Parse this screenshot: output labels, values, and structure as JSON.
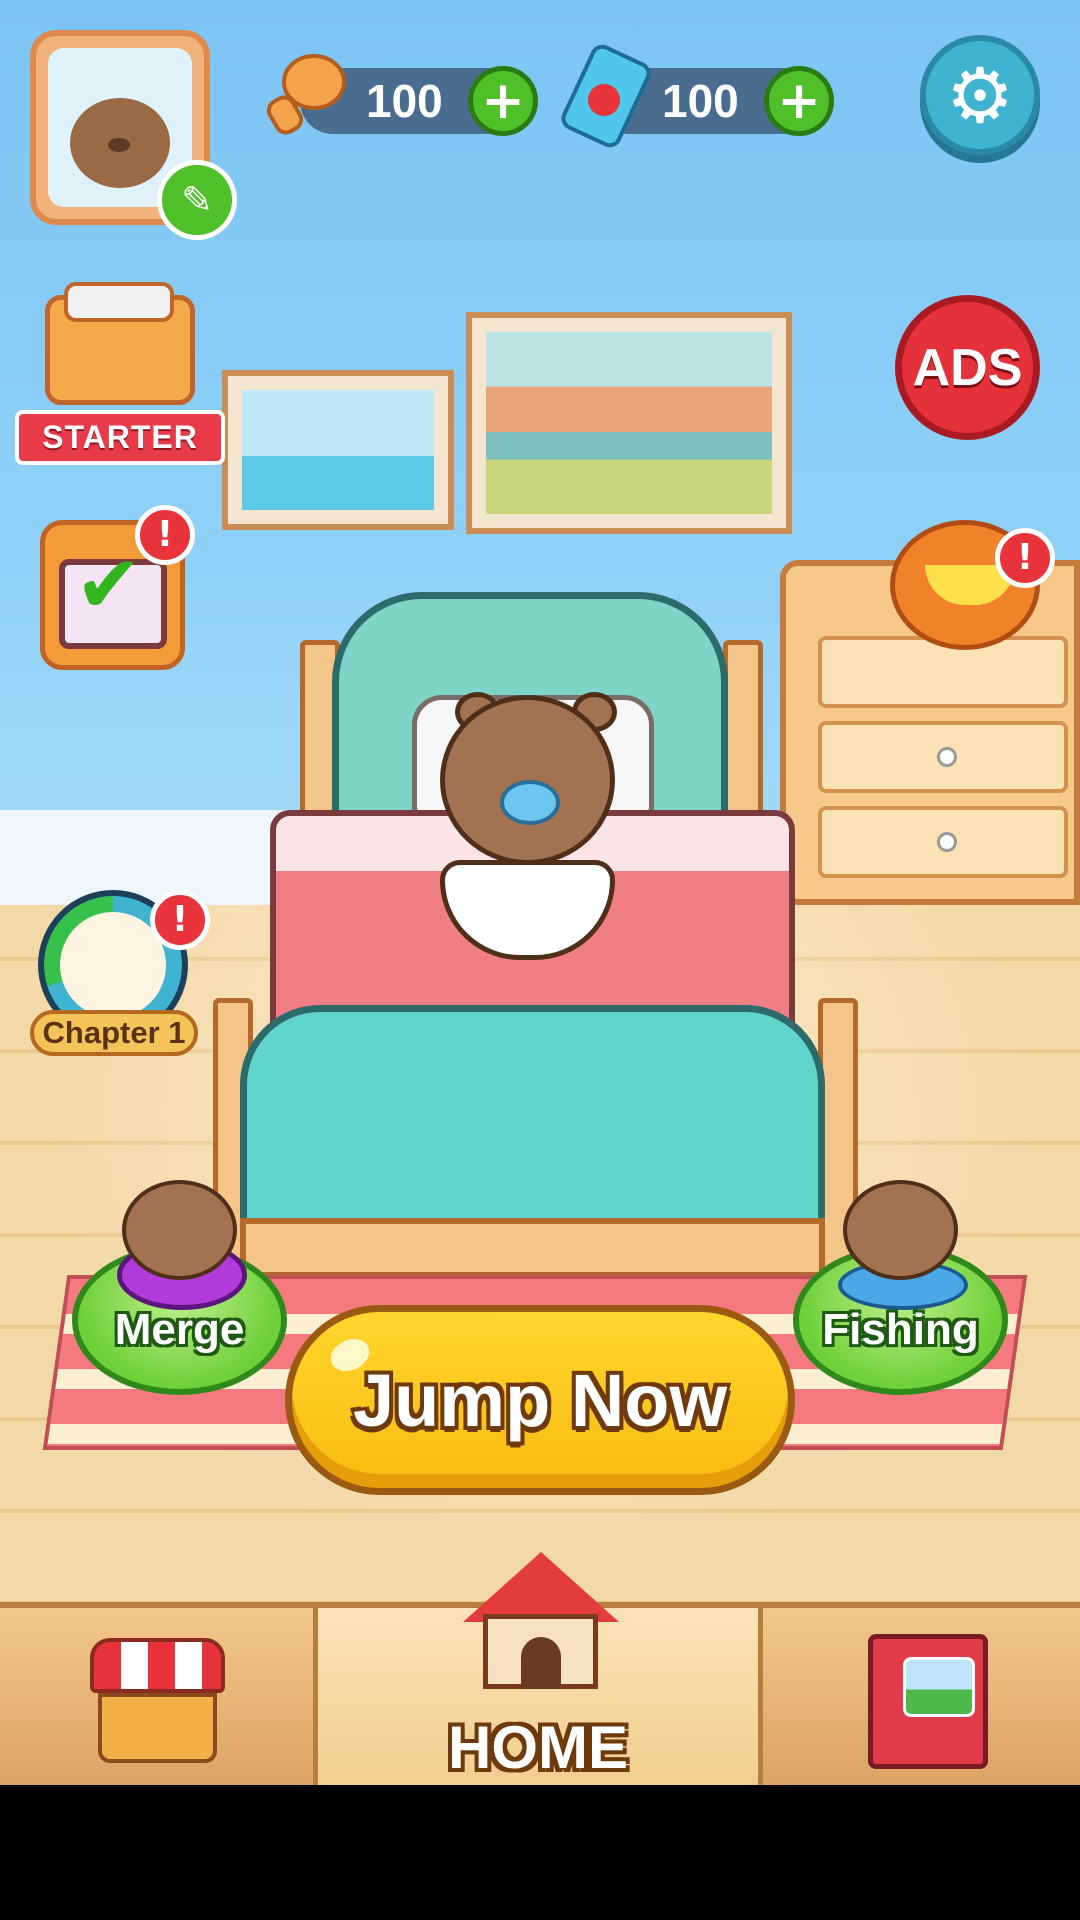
{
  "top_bar": {
    "currencies": [
      {
        "name": "hammer",
        "value": "100",
        "add_label": "+"
      },
      {
        "name": "ticket",
        "value": "100",
        "add_label": "+"
      }
    ],
    "settings_icon": "gear-icon",
    "edit_icon": "edit-icon"
  },
  "left_menu": {
    "starter_label": "STARTER",
    "alert_mark": "!",
    "chapter_label": "Chapter 1"
  },
  "right_menu": {
    "ads_label": "ADS",
    "alert_mark": "!"
  },
  "actions": {
    "merge_label": "Merge",
    "fishing_label": "Fishing",
    "jump_label": "Jump Now"
  },
  "nav": {
    "home_label": "HOME"
  },
  "colors": {
    "accent_green": "#4fbf2a",
    "accent_yellow": "#f8bb10",
    "alert_red": "#e8333b",
    "sky_blue": "#8fd0f7"
  }
}
